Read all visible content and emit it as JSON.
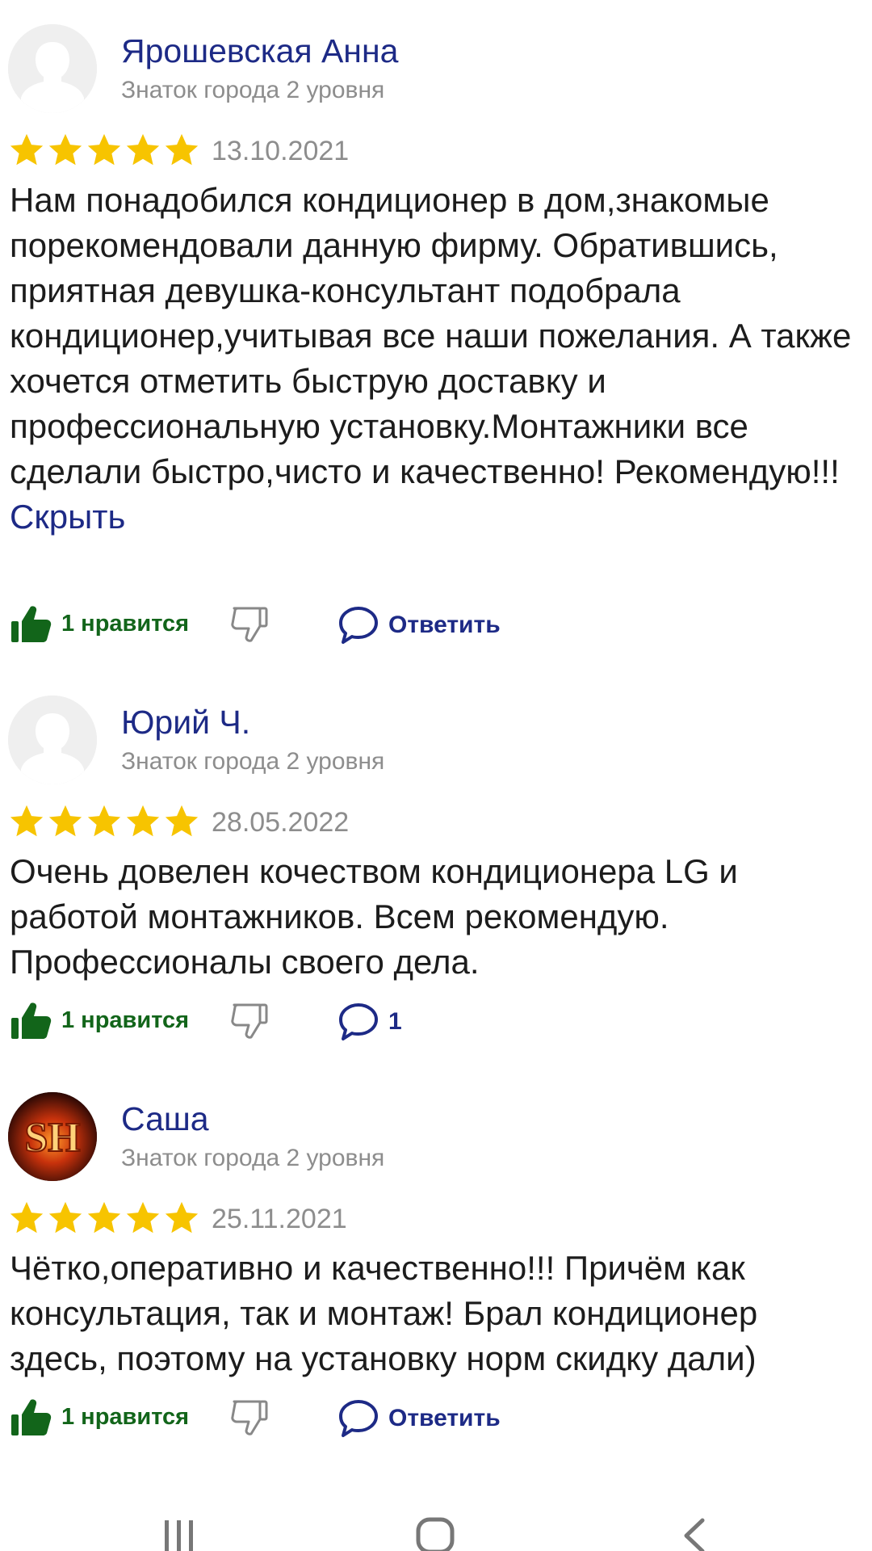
{
  "reviews": [
    {
      "author": "Ярошевская Анна",
      "level": "Знаток города 2 уровня",
      "rating": 5,
      "date": "13.10.2021",
      "text": "Нам понадобился кондиционер в дом,знакомые порекомендовали данную фирму. Обратившись, приятная девушка-консультант подобрала кондиционер,учитывая все наши пожелания. А также хочется отметить быструю доставку и профессиональную установку.Монтажники все сделали быстро,чисто и качественно! Рекомендую!!!",
      "hide_label": "Скрыть",
      "like_label": "1 нравится",
      "reply_label": "Ответить",
      "avatar": "default-person-icon"
    },
    {
      "author": "Юрий Ч.",
      "level": "Знаток города 2 уровня",
      "rating": 5,
      "date": "28.05.2022",
      "text": "Очень довелен кочеством кондиционера LG и работой монтажников. Всем рекомендую. Профессионалы своего дела.",
      "like_label": "1 нравится",
      "reply_label": "1",
      "avatar": "default-person-icon"
    },
    {
      "author": "Саша",
      "level": "Знаток города 2 уровня",
      "rating": 5,
      "date": "25.11.2021",
      "text": "Чётко,оперативно и качественно!!! Причём как консультация, так и монтаж! Брал кондиционер здесь, поэтому на установку норм скидку дали)",
      "like_label": "1 нравится",
      "reply_label": "Ответить",
      "avatar": "sh-fire-logo",
      "avatar_text": "SH"
    }
  ],
  "colors": {
    "author": "#1d2a86",
    "star": "#f7c400",
    "like": "#12651a",
    "meta": "#8d8d8d"
  },
  "icons": {
    "like": "thumbs-up-icon",
    "dislike": "thumbs-down-icon",
    "reply": "speech-bubble-icon",
    "nav_recent": "recent-apps-icon",
    "nav_home": "home-icon",
    "nav_back": "back-icon"
  }
}
